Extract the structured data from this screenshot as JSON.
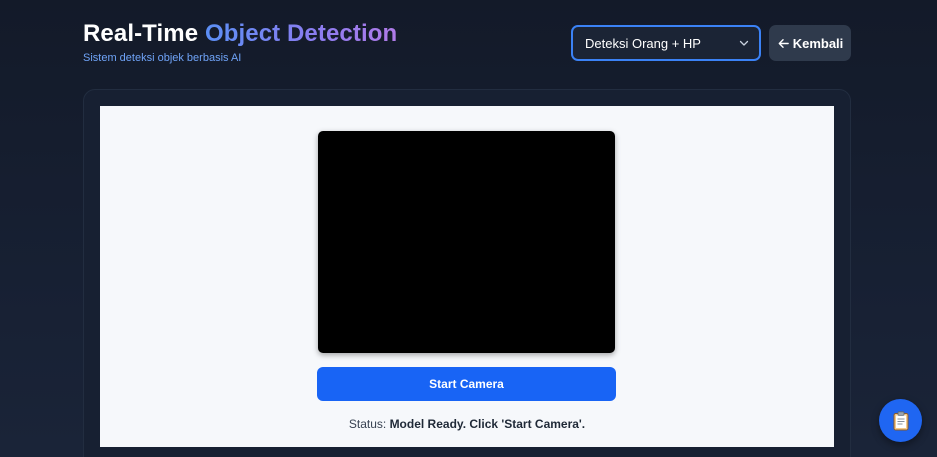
{
  "header": {
    "title_part1": "Real-Time",
    "title_part2": "Object Detection",
    "subtitle": "Sistem deteksi objek berbasis AI"
  },
  "model_select": {
    "selected": "Deteksi Orang + HP",
    "icon": "chevron-down-icon"
  },
  "back_button": {
    "label": "Kembali",
    "icon": "arrow-left-icon"
  },
  "camera": {
    "start_label": "Start Camera"
  },
  "status": {
    "label": "Status:",
    "value": "Model Ready. Click 'Start Camera'."
  },
  "fab": {
    "icon": "clipboard-icon"
  },
  "colors": {
    "background": "#151d2e",
    "accent": "#1864f5",
    "select_border": "#3b82f6",
    "title_gradient_start": "#5b8ff5",
    "title_gradient_end": "#b07be8"
  }
}
